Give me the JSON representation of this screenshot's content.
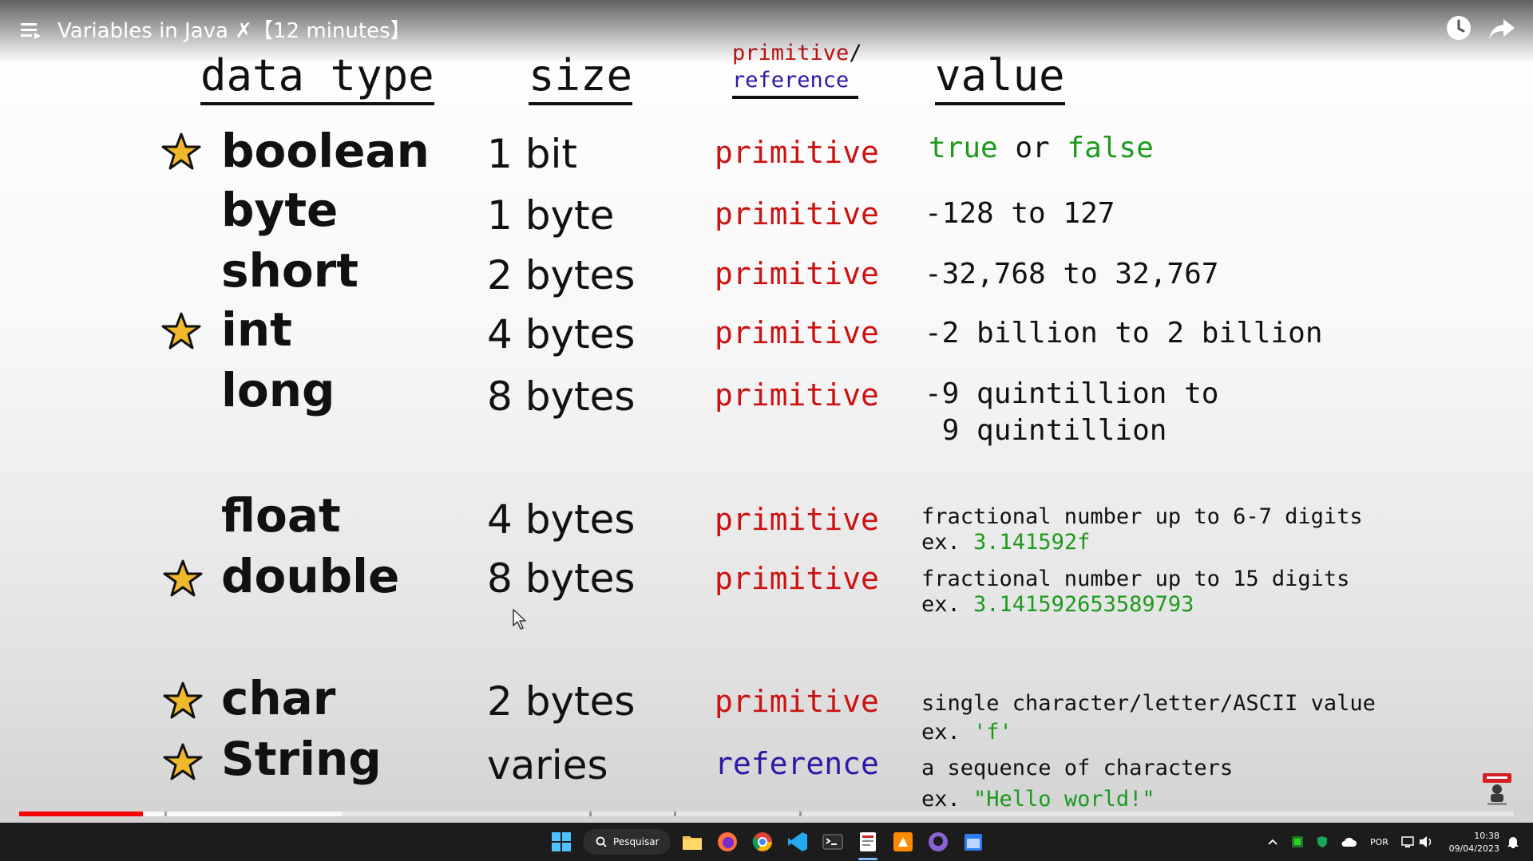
{
  "player": {
    "title": "Variables in Java ✗【12 minutes】",
    "progress_fraction": 0.083,
    "buffered_fraction": 0.216
  },
  "table": {
    "headers": {
      "data_type": "data type",
      "size": "size",
      "primitive": "primitive",
      "slash": "/",
      "reference": "reference",
      "value": "value"
    },
    "rows": [
      {
        "starred": true,
        "type": "boolean",
        "size": "1 bit",
        "kind": "primitive",
        "value_parts": [
          {
            "text": "true",
            "color": "green"
          },
          {
            "text": " or ",
            "color": "black"
          },
          {
            "text": "false",
            "color": "green"
          }
        ]
      },
      {
        "starred": false,
        "type": "byte",
        "size": "1 byte",
        "kind": "primitive",
        "value": "-128 to 127"
      },
      {
        "starred": false,
        "type": "short",
        "size": "2 bytes",
        "kind": "primitive",
        "value": "-32,768 to 32,767"
      },
      {
        "starred": true,
        "type": "int",
        "size": "4 bytes",
        "kind": "primitive",
        "value": "-2 billion to 2 billion"
      },
      {
        "starred": false,
        "type": "long",
        "size": "8 bytes",
        "kind": "primitive",
        "value_line1": "-9 quintillion to",
        "value_line2": " 9 quintillion"
      },
      {
        "starred": false,
        "type": "float",
        "size": "4 bytes",
        "kind": "primitive",
        "desc": "fractional number up to 6-7 digits",
        "ex_prefix": "ex. ",
        "ex": "3.141592f"
      },
      {
        "starred": true,
        "type": "double",
        "size": "8 bytes",
        "kind": "primitive",
        "desc": "fractional number up to 15 digits",
        "ex_prefix": "ex. ",
        "ex": "3.141592653589793"
      },
      {
        "starred": true,
        "type": "char",
        "size": "2 bytes",
        "kind": "primitive",
        "desc": "single character/letter/ASCII value",
        "ex_prefix": "ex. ",
        "ex": "'f'"
      },
      {
        "starred": true,
        "type": "String",
        "size": "varies",
        "kind": "reference",
        "desc": "a sequence of characters",
        "ex_prefix": "ex. ",
        "ex": "\"Hello world!\""
      }
    ]
  },
  "taskbar": {
    "search_label": "Pesquisar",
    "language": "POR",
    "time": "10:38",
    "date": "09/04/2023"
  },
  "colors": {
    "primitive": "#cc1111",
    "reference": "#2a1aa6",
    "green": "#1c9a1c",
    "progress": "#ff0000",
    "taskbar": "#1c1c1c"
  },
  "icons": [
    "menu-icon",
    "watch-later-icon",
    "share-icon",
    "star-icon",
    "windows-start-icon",
    "search-icon",
    "file-explorer-icon",
    "firefox-icon",
    "chrome-icon",
    "vscode-icon",
    "terminal-icon",
    "app-icon",
    "github-icon",
    "calendar-icon",
    "chevron-up-icon",
    "wifi-icon",
    "volume-icon",
    "notification-icon"
  ]
}
